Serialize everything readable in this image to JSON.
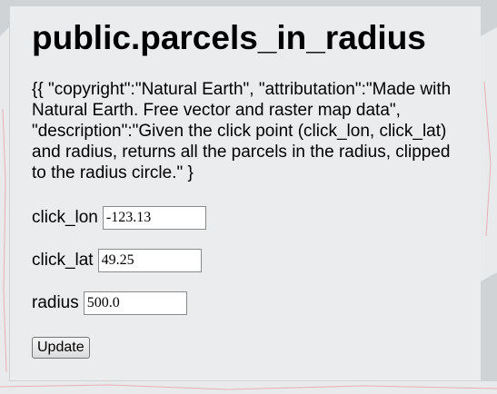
{
  "page": {
    "title": "public.parcels_in_radius",
    "description": "{{ \"copyright\":\"Natural Earth\", \"attributation\":\"Made with Natural Earth. Free vector and raster map data\", \"description\":\"Given the click point (click_lon, click_lat) and radius, returns all the parcels in the radius, clipped to the radius circle.\" }"
  },
  "form": {
    "click_lon": {
      "label": "click_lon",
      "value": "-123.13"
    },
    "click_lat": {
      "label": "click_lat",
      "value": "49.25"
    },
    "radius": {
      "label": "radius",
      "value": "500.0"
    },
    "submit_label": "Update"
  },
  "colors": {
    "map_ocean": "#cfd3d6",
    "map_land": "#e9eaeb",
    "panel": "#eceef0",
    "roads": "#e6a3a8"
  }
}
